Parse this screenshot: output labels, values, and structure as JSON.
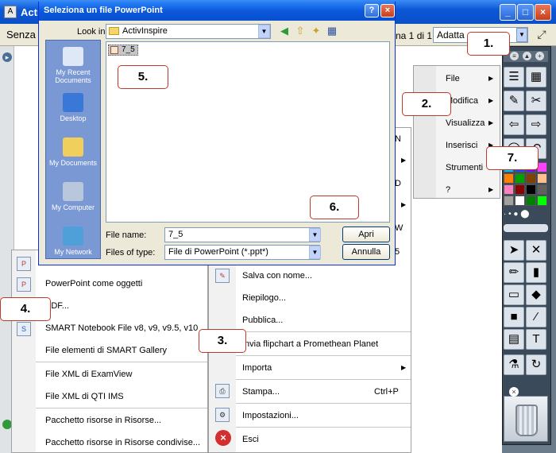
{
  "main_window": {
    "title": "ActivInspire",
    "title_truncated": "Acti",
    "document_name": "Senza",
    "page_info": "na 1 di 1",
    "zoom": "Adatta",
    "controls": [
      "_",
      "□",
      "×"
    ]
  },
  "dialog": {
    "title": "Seleziona un file PowerPoint",
    "look_in_label": "Look in:",
    "look_in_value": "ActivInspire",
    "places": [
      "My Recent Documents",
      "Desktop",
      "My Documents",
      "My Computer",
      "My Network"
    ],
    "files": [
      "7_5"
    ],
    "file_name_label": "File name:",
    "file_name_value": "7_5",
    "file_type_label": "Files of type:",
    "file_type_value": "File di PowerPoint (*.ppt*)",
    "open_button": "Apri",
    "cancel_button": "Annulla",
    "help": "?",
    "close": "×"
  },
  "main_menu": {
    "items": [
      "File",
      "Modifica",
      "Visualizza",
      "Inserisci",
      "Strumenti",
      "?"
    ]
  },
  "file_menu": {
    "items": [
      {
        "label": "Salva con nome..."
      },
      {
        "label": "Riepilogo..."
      },
      {
        "label": "Pubblica..."
      },
      {
        "label": "Invia flipchart a Promethean Planet"
      },
      {
        "label": "Importa"
      },
      {
        "label": "Stampa...",
        "shortcut": "Ctrl+P"
      },
      {
        "label": "Impostazioni..."
      },
      {
        "label": "Esci"
      }
    ],
    "partial_letters": [
      "N",
      "D",
      "W",
      "5"
    ]
  },
  "import_menu": {
    "items": [
      "PowerPoint come oggetti",
      "PDF...",
      "SMART Notebook File v8, v9, v9.5, v10",
      "File elementi di SMART Gallery",
      "File XML di ExamView",
      "File XML di QTI IMS",
      "Pacchetto risorse in Risorse...",
      "Pacchetto risorse in Risorse condivise..."
    ]
  },
  "callouts": [
    "1.",
    "2.",
    "3.",
    "4.",
    "5.",
    "6.",
    "7."
  ],
  "colors": {
    "xp_blue": "#0a58dc",
    "callout_border": "#c0392b",
    "places_bar": "#7a98d4"
  },
  "palette": [
    "#00c0ff",
    "#2040ff",
    "#8000ff",
    "#ff40ff",
    "#ff8000",
    "#00a000",
    "#804000",
    "#ffc090",
    "#ff80c0",
    "#8b0000",
    "#000000",
    "#606060",
    "#a0a0a0",
    "#ffffff",
    "#008000",
    "#00ff00"
  ]
}
